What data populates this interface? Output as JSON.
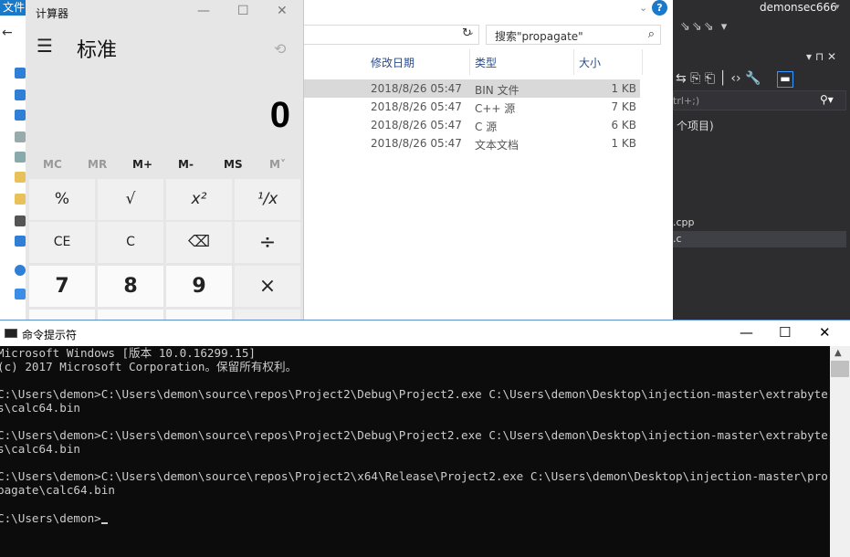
{
  "explorer": {
    "file_tab": "文件",
    "search_placeholder": "搜索\"propagate\"",
    "columns": [
      "修改日期",
      "类型",
      "大小"
    ],
    "rows": [
      {
        "date": "2018/8/26 05:47",
        "type": "BIN 文件",
        "size": "1 KB",
        "selected": true
      },
      {
        "date": "2018/8/26 05:47",
        "type": "C++ 源",
        "size": "7 KB",
        "selected": false
      },
      {
        "date": "2018/8/26 05:47",
        "type": "C 源",
        "size": "6 KB",
        "selected": false
      },
      {
        "date": "2018/8/26 05:47",
        "type": "文本文档",
        "size": "1 KB",
        "selected": false
      }
    ]
  },
  "calculator": {
    "window_title": "计算器",
    "mode": "标准",
    "display": "0",
    "memory_buttons": [
      "MC",
      "MR",
      "M+",
      "M-",
      "MS",
      "M˅"
    ],
    "keys_row1": [
      "%",
      "√",
      "x²",
      "¹/x"
    ],
    "keys_row2": [
      "CE",
      "C",
      "⌫",
      "÷"
    ],
    "keys_row3": [
      "7",
      "8",
      "9",
      "×"
    ]
  },
  "vs": {
    "user": "demonsec666",
    "search_hint": "trl+;)",
    "items_count": "个项目)",
    "files": [
      ".cpp",
      ".c"
    ]
  },
  "cmd": {
    "window_title": "命令提示符",
    "lines": [
      "Microsoft Windows [版本 10.0.16299.15]",
      "(c) 2017 Microsoft Corporation。保留所有权利。",
      "",
      "C:\\Users\\demon>C:\\Users\\demon\\source\\repos\\Project2\\Debug\\Project2.exe C:\\Users\\demon\\Desktop\\injection-master\\extrabyte",
      "s\\calc64.bin",
      "",
      "C:\\Users\\demon>C:\\Users\\demon\\source\\repos\\Project2\\Debug\\Project2.exe C:\\Users\\demon\\Desktop\\injection-master\\extrabyte",
      "s\\calc64.bin",
      "",
      "C:\\Users\\demon>C:\\Users\\demon\\source\\repos\\Project2\\x64\\Release\\Project2.exe C:\\Users\\demon\\Desktop\\injection-master\\pro",
      "pagate\\calc64.bin",
      "",
      "C:\\Users\\demon>"
    ]
  }
}
